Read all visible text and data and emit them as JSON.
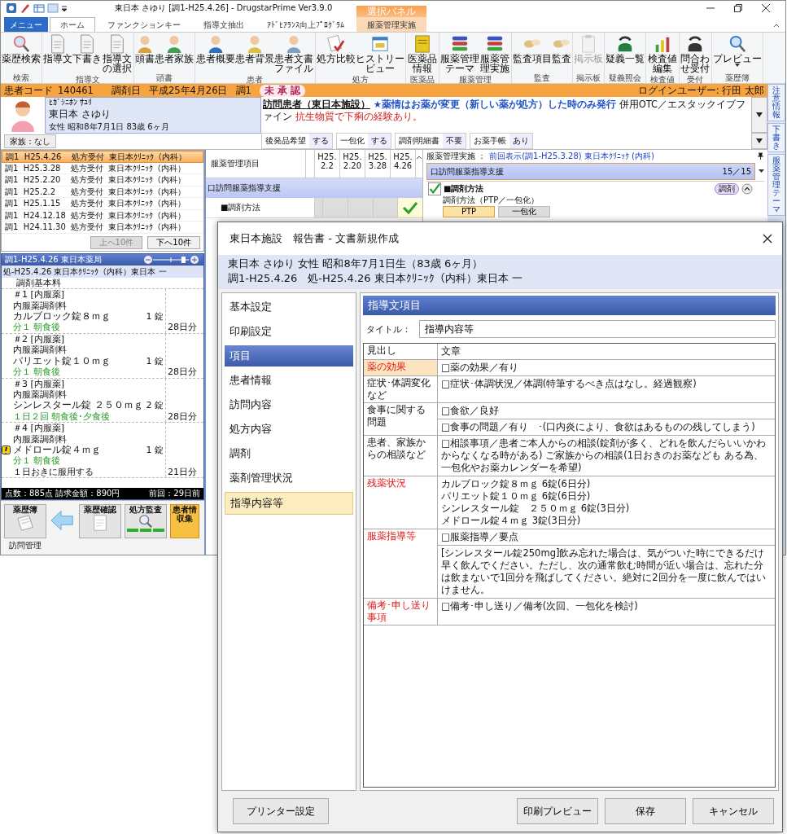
{
  "window": {
    "title": "東日本 さゆり [調1-H25.4.26] - DrugstarPrime Ver3.9.0",
    "context_label": "選択パネル"
  },
  "ribbon_tabs": [
    {
      "label": "メニュー",
      "kind": "menu",
      "selected": false
    },
    {
      "label": "ホーム",
      "kind": "tab",
      "selected": true
    },
    {
      "label": "ファンクションキー",
      "kind": "tab",
      "selected": false
    },
    {
      "label": "指導文抽出",
      "kind": "tab",
      "selected": false
    },
    {
      "label": "ｱﾄﾞﾋｱﾗﾝｽ向上ﾌﾟﾛｸﾞﾗﾑ",
      "kind": "tab",
      "selected": false
    },
    {
      "label": "服薬管理実施",
      "kind": "context",
      "selected": false
    }
  ],
  "ribbon_groups": [
    {
      "label": "検索",
      "buttons": [
        {
          "label": "薬歴検索",
          "disabled": false
        }
      ]
    },
    {
      "label": "指導文",
      "buttons": [
        {
          "label": "指導文",
          "disabled": false
        },
        {
          "label": "下書き",
          "disabled": false
        },
        {
          "label": "指導文の選択",
          "disabled": false
        }
      ]
    },
    {
      "label": "頭書",
      "buttons": [
        {
          "label": "頭書",
          "disabled": false
        },
        {
          "label": "患者家族",
          "disabled": false
        }
      ]
    },
    {
      "label": "患者",
      "buttons": [
        {
          "label": "患者概要",
          "disabled": false
        },
        {
          "label": "患者背景",
          "disabled": false
        },
        {
          "label": "患者文書ファイル",
          "disabled": false
        }
      ]
    },
    {
      "label": "処方",
      "buttons": [
        {
          "label": "処方比較",
          "disabled": false
        },
        {
          "label": "ヒストリービュー",
          "disabled": false
        }
      ]
    },
    {
      "label": "医薬品",
      "buttons": [
        {
          "label": "医薬品情報",
          "disabled": false
        }
      ]
    },
    {
      "label": "服薬管理",
      "buttons": [
        {
          "label": "服薬管理テーマ",
          "disabled": false
        },
        {
          "label": "服薬管理実施",
          "disabled": false
        }
      ]
    },
    {
      "label": "監査",
      "buttons": [
        {
          "label": "監査項目",
          "disabled": false
        },
        {
          "label": "監査",
          "disabled": false
        }
      ]
    },
    {
      "label": "掲示板",
      "buttons": [
        {
          "label": "掲示板",
          "disabled": true
        }
      ]
    },
    {
      "label": "疑義照会",
      "buttons": [
        {
          "label": "疑義一覧",
          "disabled": false
        }
      ]
    },
    {
      "label": "検査値",
      "buttons": [
        {
          "label": "検査値編集",
          "disabled": false
        }
      ]
    },
    {
      "label": "受付",
      "buttons": [
        {
          "label": "問合わせ受付",
          "disabled": false
        }
      ]
    },
    {
      "label": "薬歴簿",
      "buttons": [
        {
          "label": "プレビュー",
          "disabled": false
        }
      ]
    }
  ],
  "patient_bar": {
    "code_label": "患者コード",
    "code": "140461",
    "date_label": "調剤日",
    "date": "平成25年4月26日",
    "dispense": "調1",
    "status": "未 承 認",
    "user": "ログインユーザー:  行田  太郎"
  },
  "patient": {
    "kana": "ﾋｶﾞｼﾆﾎﾝ ｻﾕﾘ",
    "name": "東日本 さゆり",
    "details": "女性  昭和8年7月1日  83歳 6ヶ月",
    "family": "家族：なし"
  },
  "notice": {
    "facility": "訪問患者（東日本施設）",
    "info": "★薬情はお薬が変更（新しい薬が処方）した時のみ発行",
    "otc": "併用OTC／エスタックイブファイン",
    "allergy": "抗生物質で下痢の経験あり。"
  },
  "flags": [
    {
      "label": "後発品希望",
      "value": "する"
    },
    {
      "label": "一包化",
      "value": "する"
    },
    {
      "label": "調剤明細書",
      "value": "不要"
    },
    {
      "label": "お薬手帳",
      "value": "あり"
    }
  ],
  "side_tabs": [
    {
      "label": "注意情報",
      "selected": false
    },
    {
      "label": "下書き",
      "selected": false
    },
    {
      "label": "服薬管理テーマ",
      "selected": false
    }
  ],
  "history": {
    "rows": [
      {
        "text": "調1  H25.4.26    処方受付  東日本ｸﾘﾆｯｸ（内科）",
        "selected": true
      },
      {
        "text": "調1  H25.3.28    処方受付  東日本ｸﾘﾆｯｸ（内科）",
        "selected": false
      },
      {
        "text": "調1  H25.2.20    処方受付  東日本ｸﾘﾆｯｸ（内科）",
        "selected": false
      },
      {
        "text": "調1  H25.2.2      処方受付  東日本ｸﾘﾆｯｸ（内科）",
        "selected": false
      },
      {
        "text": "調1  H25.1.15    処方受付  東日本ｸﾘﾆｯｸ（内科）",
        "selected": false
      },
      {
        "text": "調1  H24.12.18  処方受付  東日本ｸﾘﾆｯｸ（内科）",
        "selected": false
      },
      {
        "text": "調1  H24.11.30  処方受付  東日本ｸﾘﾆｯｸ（内科）",
        "selected": false
      }
    ],
    "prev_button": {
      "label": "上へ10件",
      "disabled": true
    },
    "next_button": {
      "label": "下へ10件",
      "disabled": false
    }
  },
  "prescription": {
    "title": "調1-H25.4.26  東日本薬局",
    "zoom": {
      "level": 0.85
    },
    "subtitle": "処-H25.4.26 東日本ｸﾘﾆｯｸ（内科）東日本  一",
    "base_fee": "調剤基本料",
    "items": [
      {
        "number": "＃1 [内服薬]",
        "fee": "内服薬調剤料",
        "drug": "カルブロック錠８ｍｇ",
        "qty": "1  錠",
        "usage": "分１  朝食後",
        "days": "28日分",
        "warning": false
      },
      {
        "number": "＃2 [内服薬]",
        "fee": "内服薬調剤料",
        "drug": "パリエット錠１０ｍｇ",
        "qty": "1  錠",
        "usage": "分１  朝食後",
        "days": "28日分",
        "warning": false
      },
      {
        "number": "＃3 [内服薬]",
        "fee": "内服薬調剤料",
        "drug": "シンレスタール錠  ２５０ｍｇ",
        "qty": "2  錠",
        "usage": "１日２回  朝食後･夕食後",
        "days": "28日分",
        "warning": false
      },
      {
        "number": "＃4 [内服薬]",
        "fee": "内服薬調剤料",
        "drug": "メドロール錠４ｍｇ",
        "qty": "1  錠",
        "usage": "分１  朝食後",
        "days": "21日分",
        "warning": true,
        "note": "１日おきに服用する"
      }
    ],
    "totals": "点数：885点   請求金額：890円",
    "previous": "前回：29日前"
  },
  "workflow": {
    "steps": [
      {
        "label": "薬歴簿",
        "caption": "訪問管理",
        "kind": "book",
        "selected": false
      },
      {
        "label": "薬歴確認",
        "kind": "doc",
        "selected": false
      },
      {
        "label": "処方監査",
        "kind": "audit",
        "selected": false
      },
      {
        "label": "患者情収集",
        "kind": "current",
        "selected": true
      }
    ]
  },
  "grid": {
    "header": "服薬管理項目",
    "dates": [
      "H25.\n2.2",
      "H25.\n2.20",
      "H25.\n3.28",
      "H25.\n4.26"
    ],
    "section": "口訪問服薬指導支援",
    "rows": [
      {
        "label": "■調剤方法",
        "checks": [
          false,
          false,
          false,
          true
        ]
      }
    ]
  },
  "management": {
    "header": "服薬管理実施  ：",
    "previous": "前回表示(調1-H25.3.28) 東日本ｸﾘﾆｯｸ (内科)",
    "group": "口訪問服薬指導支援",
    "count": "15／15",
    "item": {
      "checked": true,
      "label": "■調剤方法",
      "badge": "調剤",
      "question": "調剤方法（PTP／一包化）",
      "options": [
        {
          "label": "PTP",
          "selected": true
        },
        {
          "label": "一包化",
          "selected": false
        }
      ]
    }
  },
  "dialog": {
    "title": "東日本施設　報告書 - 文書新規作成",
    "patient": "東日本 さゆり  女性  昭和8年7月1日生（83歳 6ヶ月）",
    "prescription": "調1-H25.4.26　処-H25.4.26 東日本ｸﾘﾆｯｸ（内科）東日本  一",
    "nav": [
      {
        "label": "基本設定",
        "kind": "plain",
        "selected": false
      },
      {
        "label": "印刷設定",
        "kind": "plain",
        "selected": false
      },
      {
        "label": "項目",
        "kind": "header",
        "selected": true
      },
      {
        "label": "患者情報",
        "kind": "plain",
        "selected": false
      },
      {
        "label": "訪問内容",
        "kind": "plain",
        "selected": false
      },
      {
        "label": "処方内容",
        "kind": "plain",
        "selected": false
      },
      {
        "label": "調剤",
        "kind": "plain",
        "selected": false
      },
      {
        "label": "薬剤管理状況",
        "kind": "plain",
        "selected": false
      },
      {
        "label": "指導内容等",
        "kind": "plain",
        "selected": true
      }
    ],
    "section": "指導文項目",
    "title_label": "タイトル：",
    "title_value": "指導内容等",
    "columns": [
      "見出し",
      "文章"
    ],
    "rows": [
      {
        "heading": "薬の効果",
        "emphasis": true,
        "selected": true,
        "cells": [
          [
            "□薬の効果／有り"
          ]
        ]
      },
      {
        "heading": "症状･体調変化など",
        "emphasis": false,
        "selected": false,
        "cells": [
          [
            "□症状･体調状況／体調(特筆するべき点はなし。経過観察)"
          ]
        ]
      },
      {
        "heading": "食事に関する問題",
        "emphasis": false,
        "selected": false,
        "cells": [
          [
            "□食欲／良好"
          ],
          [
            "□食事の問題／有り　･(口内炎により、食欲はあるものの残してしまう)"
          ]
        ]
      },
      {
        "heading": "患者、家族からの相談など",
        "emphasis": false,
        "selected": false,
        "cells": [
          [
            "□相談事項／患者ご本人からの相談(錠剤が多く、どれを飲んだらいいかわからなくなる時がある) ご家族からの相談(1日おきのお薬なども ある為、一包化やお薬カレンダーを希望)"
          ]
        ]
      },
      {
        "heading": "残薬状況",
        "emphasis": true,
        "selected": false,
        "cells": [
          [
            "カルブロック錠８ｍｇ 6錠(6日分)",
            "パリエット錠１０ｍｇ 6錠(6日分)",
            "シンレスタール錠　２５０ｍｇ 6錠(3日分)",
            "メドロール錠４ｍｇ 3錠(3日分)"
          ]
        ]
      },
      {
        "heading": "服薬指導等",
        "emphasis": true,
        "selected": false,
        "cells": [
          [
            "□服薬指導／要点"
          ],
          [
            "[シンレスタール錠250mg]飲み忘れた場合は、気がついた時にできるだけ早く飲んでください。ただし、次の通常飲む時間が近い場合は、忘れた分は飲まないで1回分を飛ばしてください。絶対に2回分を一度に飲んではいけません。"
          ]
        ]
      },
      {
        "heading": "備考･申し送り事項",
        "emphasis": true,
        "selected": false,
        "cells": [
          [
            "□備考･申し送り／備考(次回、一包化を検討)"
          ]
        ]
      }
    ],
    "buttons": [
      {
        "label": "プリンター設定",
        "kind": "left"
      },
      {
        "label": "印刷プレビュー",
        "kind": "right"
      },
      {
        "label": "保存",
        "kind": "right"
      },
      {
        "label": "キャンセル",
        "kind": "right"
      }
    ]
  }
}
